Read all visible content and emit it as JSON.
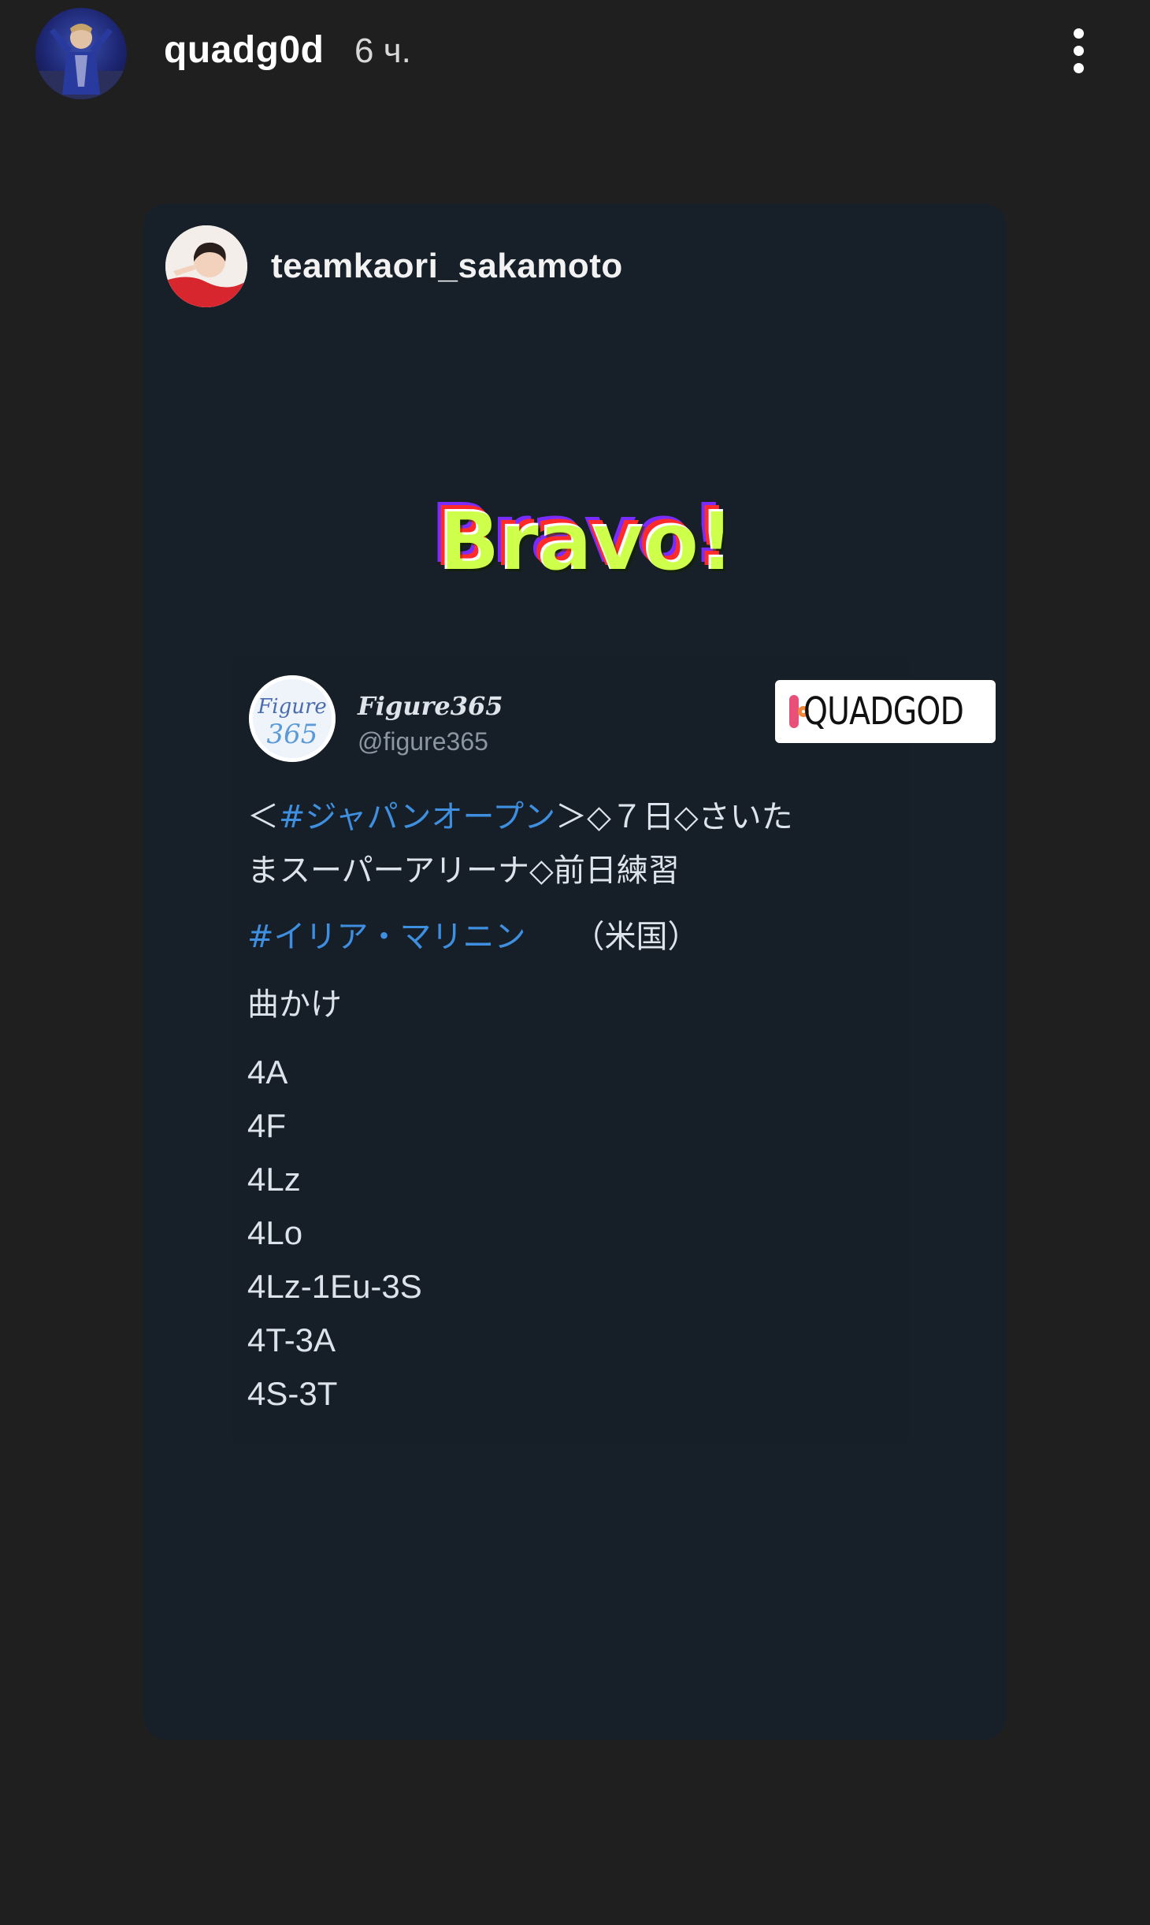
{
  "story": {
    "username": "quadg0d",
    "time": "6 ч."
  },
  "post": {
    "author": "teamkaori_sakamoto",
    "sticker": "Bravo!"
  },
  "tweet": {
    "display_name": "Figure365",
    "handle": "@figure365",
    "badge": "QUADGOD",
    "line1_open": "＜",
    "line1_hashtag": "#ジャパンオープン",
    "line1_rest": "＞◇７日◇さいた",
    "line2": "まスーパーアリーナ◇前日練習",
    "line3_hashtag": "#イリア・マリニン",
    "line3_rest": "（米国）",
    "line4": "曲かけ",
    "elements": [
      "4A",
      "4F",
      "4Lz",
      "4Lo",
      "4Lz-1Eu-3S",
      "4T-3A",
      "4S-3T"
    ]
  }
}
